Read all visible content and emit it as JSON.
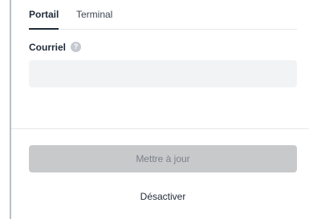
{
  "tabs": {
    "portal": "Portail",
    "terminal": "Terminal"
  },
  "form": {
    "email_label": "Courriel",
    "help_icon": "question-circle-icon",
    "email_value": "",
    "email_placeholder": ""
  },
  "actions": {
    "update_label": "Mettre à jour",
    "deactivate_label": "Désactiver"
  }
}
